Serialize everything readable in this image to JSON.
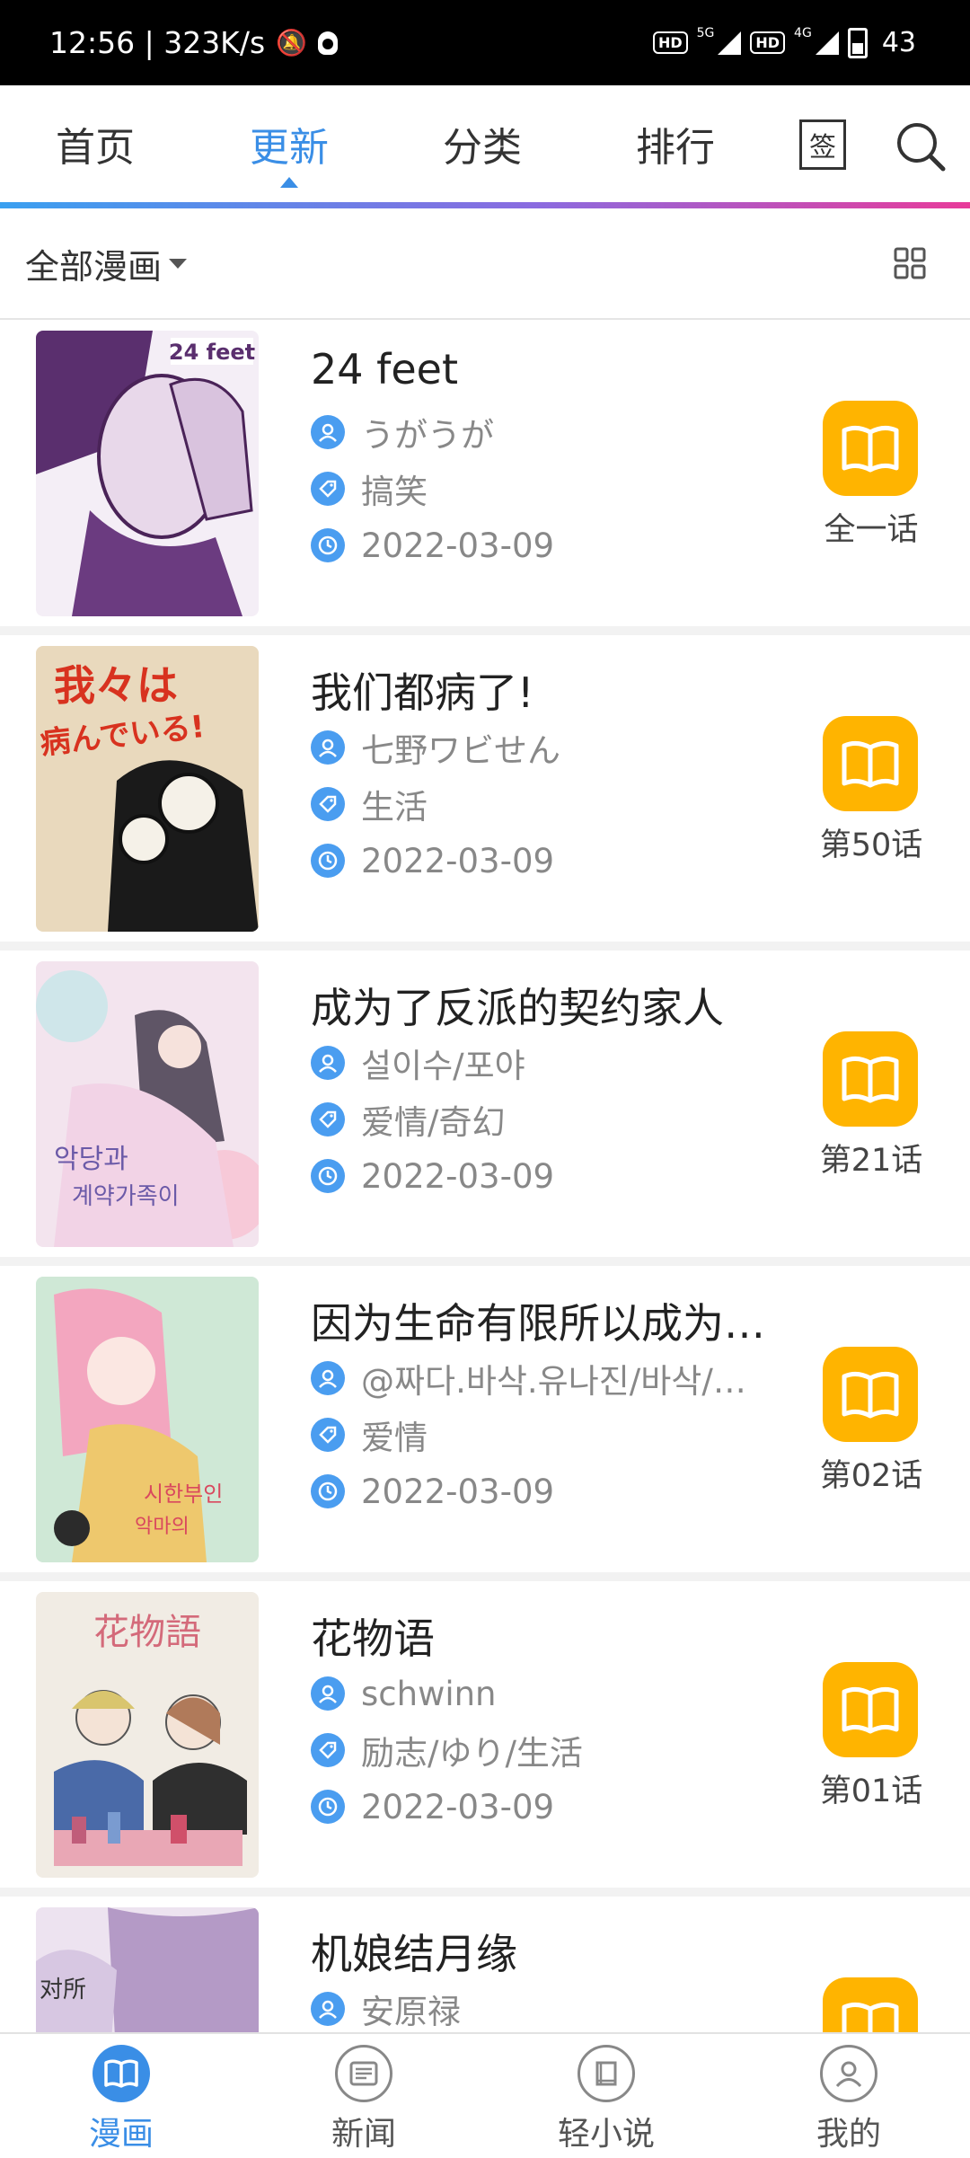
{
  "status_bar": {
    "time_speed": "12:56 | 323K/s",
    "hd1": "HD",
    "net1": "5G",
    "hd2": "HD",
    "net2": "4G",
    "battery": "43"
  },
  "top_nav": {
    "tabs": [
      {
        "label": "首页"
      },
      {
        "label": "更新",
        "active": true
      },
      {
        "label": "分类"
      },
      {
        "label": "排行"
      }
    ],
    "sign_label": "签"
  },
  "filter": {
    "label": "全部漫画"
  },
  "comics": [
    {
      "title": " 24 feet",
      "author": "うがうが",
      "tags": "搞笑",
      "date": "2022-03-09",
      "chapter": "全一话"
    },
    {
      "title": "我们都病了!",
      "author": "七野ワビせん",
      "tags": "生活",
      "date": "2022-03-09",
      "chapter": "第50话"
    },
    {
      "title": "成为了反派的契约家人",
      "author": "설이수/포야",
      "tags": "爱情/奇幻",
      "date": "2022-03-09",
      "chapter": "第21话"
    },
    {
      "title": "因为生命有限所以成为…",
      "author": "@짜다.바삭.유나진/바삭/…",
      "tags": "爱情",
      "date": "2022-03-09",
      "chapter": "第02话"
    },
    {
      "title": "花物语",
      "author": "schwinn",
      "tags": "励志/ゆり/生活",
      "date": "2022-03-09",
      "chapter": "第01话"
    },
    {
      "title": "机娘结月缘",
      "author": "安原禄",
      "tags": "",
      "date": "",
      "chapter": ""
    }
  ],
  "cover_texts": {
    "c1": "24 feet",
    "c2a": "我々は",
    "c2b": "病んでいる!",
    "c5": "花物語"
  },
  "bottom_nav": {
    "items": [
      {
        "label": "漫画",
        "active": true
      },
      {
        "label": "新闻"
      },
      {
        "label": "轻小说"
      },
      {
        "label": "我的"
      }
    ]
  },
  "colors": {
    "accent": "#3a8ee6",
    "read_button": "#ffb400",
    "meta_icon": "#4a9df0"
  }
}
